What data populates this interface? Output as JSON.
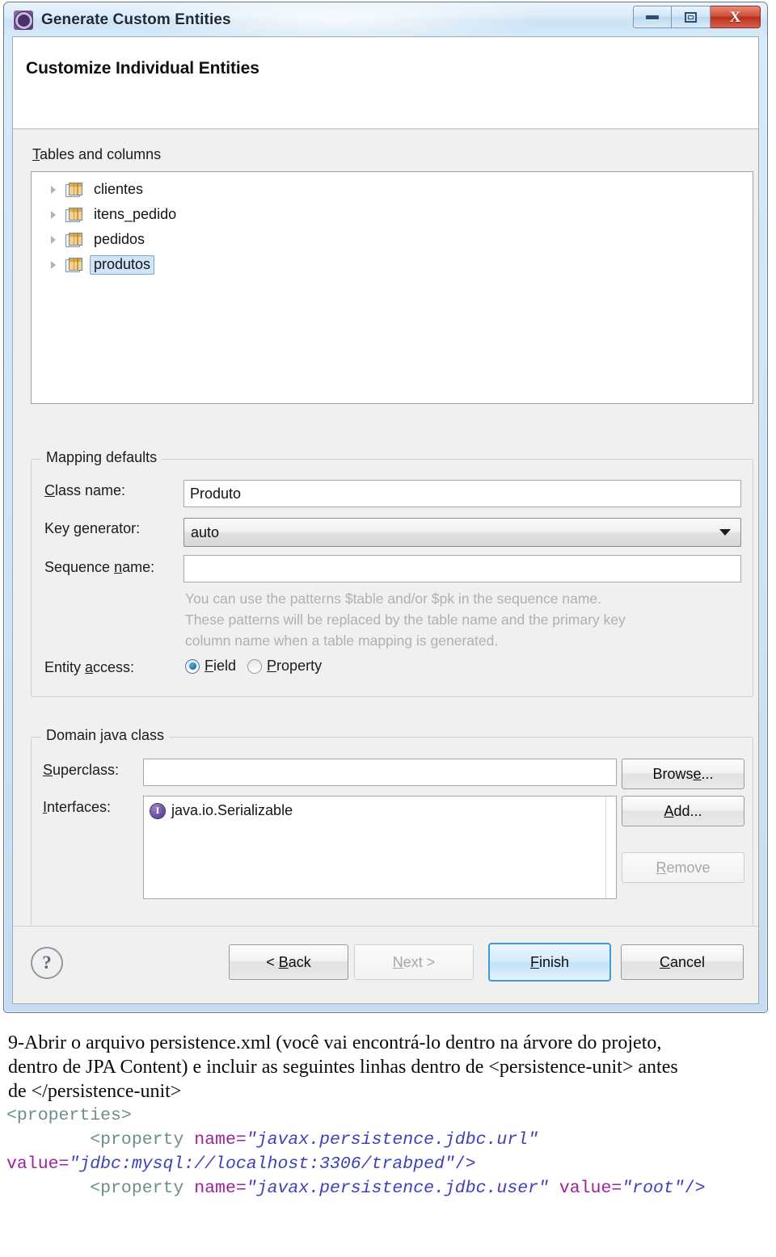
{
  "window": {
    "title": "Generate Custom Entities",
    "app_icon": "gear-icon",
    "controls": {
      "minimize": "minimize-icon",
      "maximize": "restore-icon",
      "close": "X"
    }
  },
  "dialog": {
    "header_title": "Customize Individual Entities",
    "tables_section": {
      "label_prefix": "T",
      "label_rest": "ables and columns",
      "items": [
        {
          "name": "clientes",
          "selected": false
        },
        {
          "name": "itens_pedido",
          "selected": false
        },
        {
          "name": "pedidos",
          "selected": false
        },
        {
          "name": "produtos",
          "selected": true
        }
      ]
    },
    "mapping_defaults": {
      "caption": "Mapping defaults",
      "class_name": {
        "label_a": "C",
        "label_b": "lass name:",
        "value": "Produto"
      },
      "key_generator": {
        "label_a": "Key ",
        "label_b": "g",
        "label_c": "enerator:",
        "value": "auto"
      },
      "sequence_name": {
        "label_a": "Sequence ",
        "label_b": "n",
        "label_c": "ame:",
        "value": "",
        "placeholder": ""
      },
      "hint_lines": [
        "You can use the patterns $table and/or $pk in the sequence name.",
        "These patterns will be replaced by the table name and the primary key",
        "column name when a table mapping is generated."
      ],
      "entity_access": {
        "label_a": "Entity ",
        "label_b": "a",
        "label_c": "ccess:",
        "options": [
          {
            "mn": "F",
            "rest": "ield",
            "selected": true
          },
          {
            "mn": "P",
            "rest": "roperty",
            "selected": false
          }
        ]
      }
    },
    "domain_java_class": {
      "caption": "Domain java class",
      "superclass": {
        "label_a": "S",
        "label_b": "uperclass:",
        "value": ""
      },
      "interfaces": {
        "label_a": "I",
        "label_b": "nterfaces:",
        "items": [
          {
            "icon": "interface-icon",
            "name": "java.io.Serializable"
          }
        ]
      },
      "buttons": [
        {
          "pre": "Brows",
          "mn": "e",
          "post": "...",
          "enabled": true
        },
        {
          "pre": "",
          "mn": "A",
          "post": "dd...",
          "enabled": true
        },
        {
          "pre": "",
          "mn": "R",
          "post": "emove",
          "enabled": false
        }
      ]
    },
    "buttonbar": {
      "help": "?",
      "buttons": [
        {
          "pre": "< ",
          "mn": "B",
          "post": "ack",
          "enabled": true,
          "default": false
        },
        {
          "pre": "",
          "mn": "N",
          "post": "ext >",
          "enabled": false,
          "default": false
        },
        {
          "pre": "",
          "mn": "F",
          "post": "inish",
          "enabled": true,
          "default": true
        },
        {
          "pre": "",
          "mn": "C",
          "post": "ancel",
          "enabled": true,
          "default": false
        }
      ]
    }
  },
  "document": {
    "paragraph_lines": [
      "9-Abrir o arquivo persistence.xml (você vai encontrá-lo dentro na árvore do projeto,",
      "dentro de JPA Content) e incluir as seguintes linhas dentro de <persistence-unit> antes",
      "de  </persistence-unit>"
    ],
    "code_lines": [
      {
        "parts": [
          {
            "t": "<properties>",
            "c": "tag"
          }
        ]
      },
      {
        "parts": [
          {
            "t": "        ",
            "c": "plain"
          },
          {
            "t": "<property",
            "c": "tag"
          },
          {
            "t": " ",
            "c": "plain"
          },
          {
            "t": "name=",
            "c": "attr"
          },
          {
            "t": "\"javax.persistence.jdbc.url\"",
            "c": "val"
          }
        ]
      },
      {
        "parts": [
          {
            "t": "value=",
            "c": "attr"
          },
          {
            "t": "\"jdbc:mysql://localhost:3306/trabped\"",
            "c": "val"
          },
          {
            "t": "/>",
            "c": "brk"
          }
        ]
      },
      {
        "parts": [
          {
            "t": "        ",
            "c": "plain"
          },
          {
            "t": "<property",
            "c": "tag"
          },
          {
            "t": " ",
            "c": "plain"
          },
          {
            "t": "name=",
            "c": "attr"
          },
          {
            "t": "\"javax.persistence.jdbc.user\"",
            "c": "val"
          },
          {
            "t": " ",
            "c": "plain"
          },
          {
            "t": "value=",
            "c": "attr"
          },
          {
            "t": "\"root\"",
            "c": "val"
          },
          {
            "t": "/>",
            "c": "brk"
          }
        ]
      }
    ]
  },
  "colors": {
    "accent_blue": "#3c9bdc",
    "selection": "#cfe4f7",
    "close_red": "#b8301c",
    "hint_gray": "#b0b0b0",
    "code_tag": "#6e8d8d",
    "code_attr": "#a020a0",
    "code_value": "#3f3fbf"
  }
}
